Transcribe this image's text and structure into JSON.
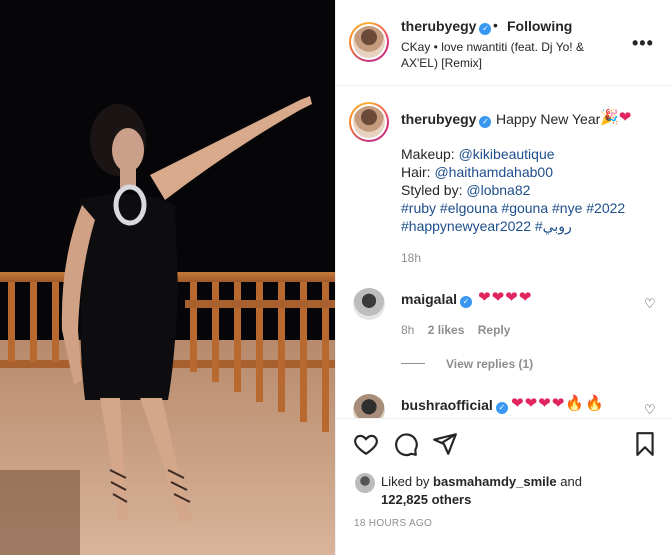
{
  "post": {
    "username": "therubyegy",
    "follow_dot": "•",
    "follow_status": "Following",
    "audio": "CKay • love nwantiti (feat. Dj Yo! & AX'EL) [Remix]",
    "more_icon": "more-icon"
  },
  "caption": {
    "username": "therubyegy",
    "text": "Happy New Year",
    "emojis": "🎉",
    "heart": "❤",
    "line_makeup_prefix": "Makeup: ",
    "makeup_handle": "@kikibeautique",
    "line_hair_prefix": "Hair: ",
    "hair_handle": "@haithamdahab00",
    "line_styled_prefix": "Styled by: ",
    "styled_handle": "@lobna82",
    "tags_line1": "#ruby #elgouna #gouna #nye #2022",
    "tags_line2": "#happynewyear2022 #روبي",
    "time": "18h"
  },
  "comments": [
    {
      "username": "maigalal",
      "text": "❤❤❤❤",
      "time": "8h",
      "likes": "2 likes",
      "reply": "Reply",
      "view_replies": "View replies (1)"
    },
    {
      "username": "bushraofficial",
      "text": "❤❤❤❤🔥🔥"
    }
  ],
  "likes": {
    "prefix": "Liked by ",
    "user": "basmahamdy_smile",
    "and": " and",
    "count": "122,825 others"
  },
  "timestamp": "18 HOURS AGO",
  "colors": {
    "link": "#1e4e8c",
    "heart": "#e0245e",
    "verified": "#3897f0"
  }
}
